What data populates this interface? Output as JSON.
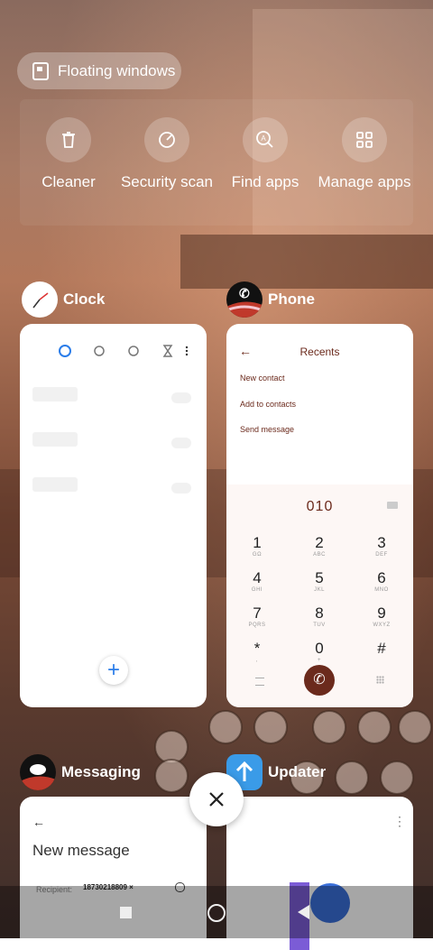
{
  "floating_windows": {
    "label": "Floating windows"
  },
  "tools": [
    {
      "icon": "trash-icon",
      "label": "Cleaner"
    },
    {
      "icon": "speedometer-icon",
      "label": "Security scan"
    },
    {
      "icon": "search-apps-icon",
      "label": "Find apps"
    },
    {
      "icon": "grid-icon",
      "label": "Manage apps"
    }
  ],
  "apps": {
    "clock": {
      "name": "Clock"
    },
    "phone": {
      "name": "Phone"
    },
    "messaging": {
      "name": "Messaging"
    },
    "updater": {
      "name": "Updater"
    }
  },
  "phone_card": {
    "title": "Recents",
    "actions": [
      "New contact",
      "Add to contacts",
      "Send message"
    ],
    "number": "010",
    "keys": [
      {
        "n": "1",
        "l": "GΩ"
      },
      {
        "n": "2",
        "l": "ABC"
      },
      {
        "n": "3",
        "l": "DEF"
      },
      {
        "n": "4",
        "l": "GHI"
      },
      {
        "n": "5",
        "l": "JKL"
      },
      {
        "n": "6",
        "l": "MNO"
      },
      {
        "n": "7",
        "l": "PQRS"
      },
      {
        "n": "8",
        "l": "TUV"
      },
      {
        "n": "9",
        "l": "WXYZ"
      },
      {
        "n": "*",
        "l": ","
      },
      {
        "n": "0",
        "l": "+"
      },
      {
        "n": "#",
        "l": ""
      }
    ]
  },
  "messaging_card": {
    "title": "New message",
    "recipient_label": "Recipient:",
    "recipient_value": "18730218809"
  },
  "colors": {
    "accent_phone": "#6b2a1c",
    "clock_blue": "#2b7de9"
  }
}
